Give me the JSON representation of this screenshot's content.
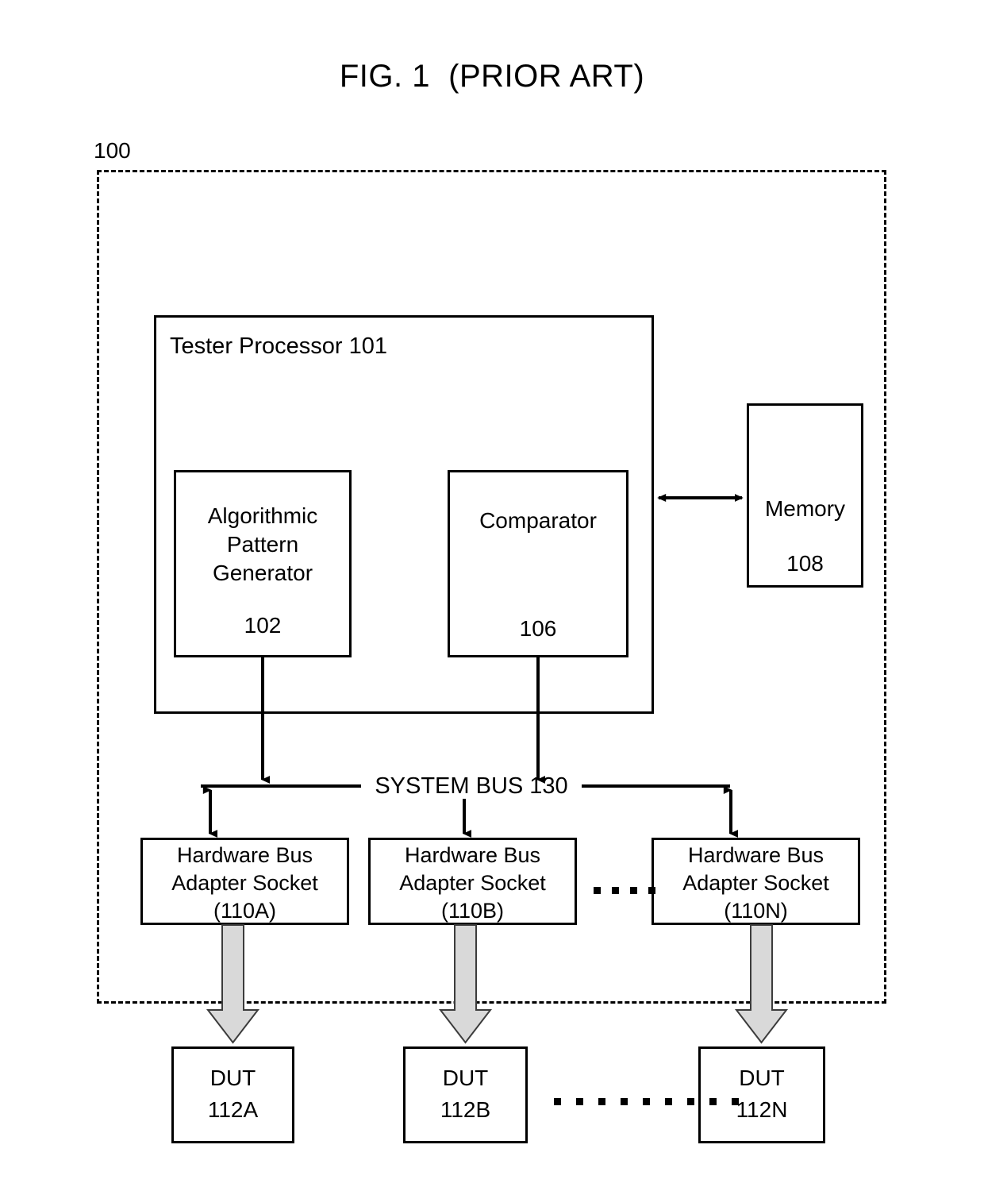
{
  "figure": {
    "title": "FIG. 1  (PRIOR ART)",
    "system_reference_numeral": "100"
  },
  "tester_processor": {
    "title": "Tester Processor 101",
    "blocks": [
      {
        "name": "Algorithmic Pattern Generator",
        "label": "Algorithmic\nPattern\nGenerator",
        "number": "102"
      },
      {
        "name": "Comparator",
        "label": "Comparator",
        "number": "106"
      }
    ]
  },
  "memory": {
    "label": "Memory",
    "number": "108"
  },
  "bus": {
    "label": "SYSTEM BUS 130"
  },
  "sockets": [
    {
      "label": "Hardware Bus\nAdapter Socket\n(110A)",
      "id": "110A"
    },
    {
      "label": "Hardware Bus\nAdapter Socket\n(110B)",
      "id": "110B"
    },
    {
      "label": "Hardware Bus\nAdapter Socket\n(110N)",
      "id": "110N"
    }
  ],
  "socket_ellipsis_dots": 4,
  "duts": [
    {
      "label": "DUT\n112A",
      "id": "112A"
    },
    {
      "label": "DUT\n112B",
      "id": "112B"
    },
    {
      "label": "DUT\n112N",
      "id": "112N"
    }
  ],
  "dut_ellipsis_dots": 9,
  "colors": {
    "line": "#000000",
    "background": "#ffffff",
    "block_arrow_fill": "#d9d9d9",
    "block_arrow_stroke": "#3c3c3c"
  }
}
